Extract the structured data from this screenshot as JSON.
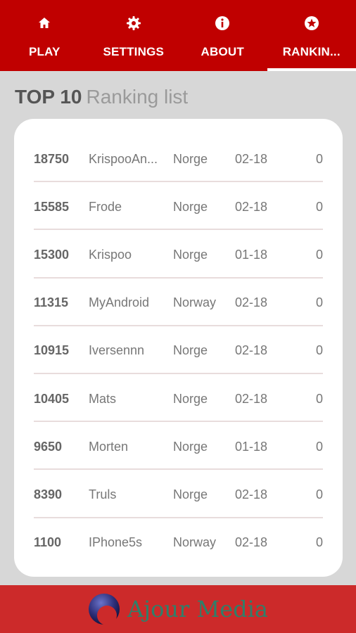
{
  "tabs": [
    {
      "label": "PLAY",
      "icon": "home-icon",
      "active": false
    },
    {
      "label": "SETTINGS",
      "icon": "gear-icon",
      "active": false
    },
    {
      "label": "ABOUT",
      "icon": "info-icon",
      "active": false
    },
    {
      "label": "RANKIN...",
      "icon": "star-icon",
      "active": true
    }
  ],
  "heading": {
    "top": "TOP 10",
    "subtitle": "Ranking list"
  },
  "ranking": [
    {
      "score": "18750",
      "name": "KrispooAn...",
      "country": "Norge",
      "date": "02-18",
      "extra": "0"
    },
    {
      "score": "15585",
      "name": "Frode",
      "country": "Norge",
      "date": "02-18",
      "extra": "0"
    },
    {
      "score": "15300",
      "name": "Krispoo",
      "country": "Norge",
      "date": "01-18",
      "extra": "0"
    },
    {
      "score": "11315",
      "name": "MyAndroid",
      "country": "Norway",
      "date": "02-18",
      "extra": "0"
    },
    {
      "score": "10915",
      "name": "Iversennn",
      "country": "Norge",
      "date": "02-18",
      "extra": "0"
    },
    {
      "score": "10405",
      "name": "Mats",
      "country": "Norge",
      "date": "02-18",
      "extra": "0"
    },
    {
      "score": "9650",
      "name": "Morten",
      "country": "Norge",
      "date": "01-18",
      "extra": "0"
    },
    {
      "score": "8390",
      "name": "Truls",
      "country": "Norge",
      "date": "02-18",
      "extra": "0"
    },
    {
      "score": "1100",
      "name": "IPhone5s",
      "country": "Norway",
      "date": "02-18",
      "extra": "0"
    }
  ],
  "footer": {
    "brand": "Ajour Media"
  },
  "colors": {
    "tabbar": "#c00000",
    "footer": "#cc2a2a",
    "brand_text": "#2f7f6a"
  }
}
